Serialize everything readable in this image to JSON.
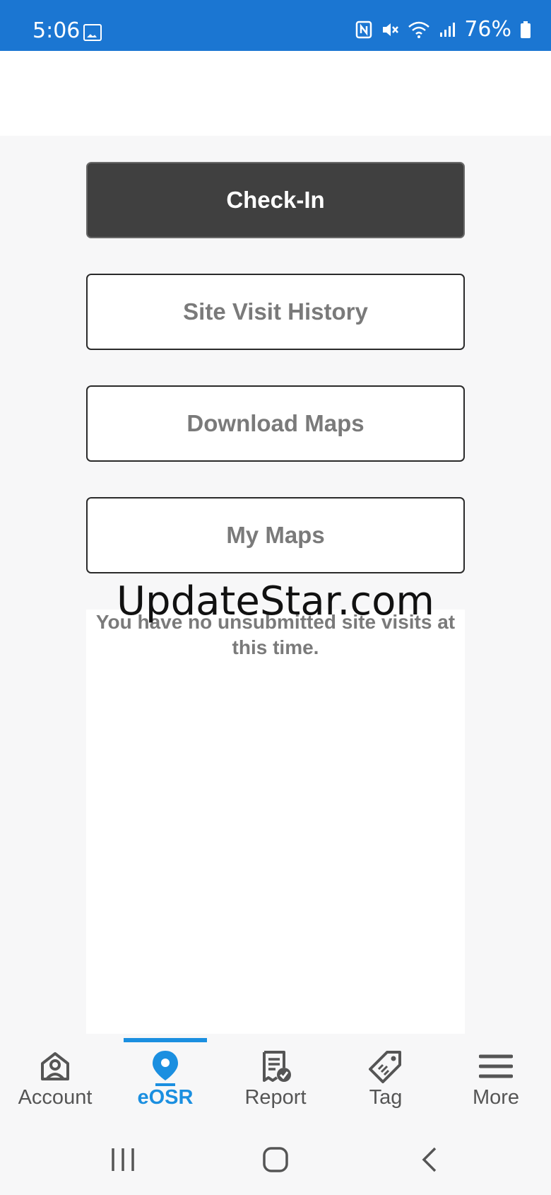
{
  "status_bar": {
    "time": "5:06",
    "battery": "76%",
    "icons": [
      "image-icon",
      "nfc-icon",
      "mute-icon",
      "wifi-icon",
      "signal-icon",
      "battery-icon"
    ]
  },
  "actions": {
    "check_in": "Check-In",
    "site_visit_history": "Site Visit History",
    "download_maps": "Download Maps",
    "my_maps": "My Maps"
  },
  "empty_message": "You have no unsubmitted site visits at this time.",
  "watermark": "UpdateStar.com",
  "tabs": [
    {
      "label": "Account",
      "icon": "account-icon"
    },
    {
      "label": "eOSR",
      "icon": "location-pin-icon",
      "active": true
    },
    {
      "label": "Report",
      "icon": "report-icon"
    },
    {
      "label": "Tag",
      "icon": "tag-icon"
    },
    {
      "label": "More",
      "icon": "menu-icon"
    }
  ],
  "colors": {
    "status_bar": "#1b76d2",
    "primary_button": "#404040",
    "active_tab": "#1b8fe0"
  }
}
